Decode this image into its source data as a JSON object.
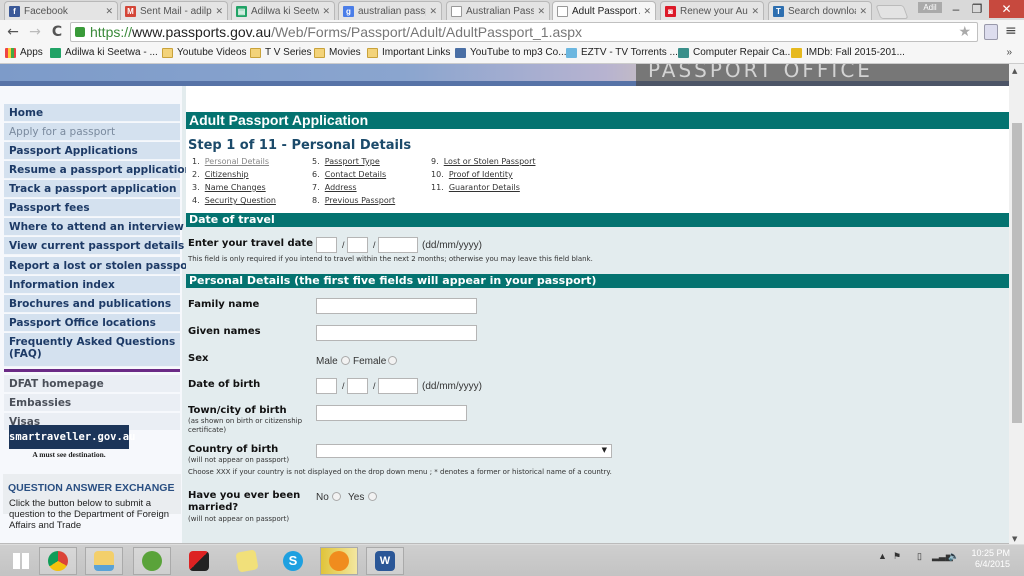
{
  "browser": {
    "tabs": [
      {
        "label": "Facebook",
        "icon": "facebook-icon",
        "color": "#3b5998",
        "glyph": "f",
        "active": false
      },
      {
        "label": "Sent Mail - adilp",
        "icon": "gmail-icon",
        "color": "#d44638",
        "glyph": "M",
        "active": false
      },
      {
        "label": "Adilwa ki Seetwa",
        "icon": "sheets-icon",
        "color": "#21a366",
        "glyph": "▤",
        "active": false
      },
      {
        "label": "australian passp",
        "icon": "google-icon",
        "color": "#4a7de8",
        "glyph": "g",
        "active": false
      },
      {
        "label": "Australian Passp",
        "icon": "page-icon",
        "color": "#ffffff",
        "glyph": "",
        "active": false
      },
      {
        "label": "Adult Passport A",
        "icon": "page-icon",
        "color": "#ffffff",
        "glyph": "",
        "active": true
      },
      {
        "label": "Renew your Aust",
        "icon": "auspost-icon",
        "color": "#dc1928",
        "glyph": "◙",
        "active": false
      },
      {
        "label": "Search download",
        "icon": "torrentz-icon",
        "color": "#2e6fb0",
        "glyph": "T",
        "active": false
      }
    ],
    "user_badge": "Adil",
    "window_controls": {
      "minimize": "–",
      "maximize": "❐",
      "close": "✕"
    },
    "url": {
      "scheme": "https://",
      "host": "www.passports.gov.au",
      "path": "/Web/Forms/Passport/Adult/AdultPassport_1.aspx"
    },
    "bookmarks": [
      {
        "label": "Apps",
        "icon": "apps-icon"
      },
      {
        "label": "Adilwa ki Seetwa - ...",
        "icon": "sheets-icon"
      },
      {
        "label": "Youtube Videos",
        "icon": "folder-icon"
      },
      {
        "label": "T V Series",
        "icon": "folder-icon"
      },
      {
        "label": "Movies",
        "icon": "folder-icon"
      },
      {
        "label": "Important Links",
        "icon": "folder-icon"
      },
      {
        "label": "YouTube to mp3 Co...",
        "icon": "yt-mp3-icon"
      },
      {
        "label": "EZTV - TV Torrents ...",
        "icon": "eztv-icon"
      },
      {
        "label": "Computer Repair Ca...",
        "icon": "house-icon"
      },
      {
        "label": "IMDb: Fall 2015-201...",
        "icon": "imdb-icon"
      }
    ],
    "bookmarks_overflow": "»"
  },
  "banner": {
    "text": "PASSPORT OFFICE"
  },
  "sidebar": {
    "items": [
      {
        "label": "Home",
        "muted": false
      },
      {
        "label": "Apply for a passport",
        "muted": true
      },
      {
        "label": "Passport Applications",
        "muted": false
      },
      {
        "label": "Resume a passport application",
        "muted": false
      },
      {
        "label": "Track a passport application",
        "muted": false
      },
      {
        "label": "Passport fees",
        "muted": false
      },
      {
        "label": "Where to attend an interview",
        "muted": false
      },
      {
        "label": "View current passport details",
        "muted": false
      },
      {
        "label": "Report a lost or stolen passport",
        "muted": false
      },
      {
        "label": "Information index",
        "muted": false
      },
      {
        "label": "Brochures and publications",
        "muted": false
      },
      {
        "label": "Passport Office locations",
        "muted": false
      },
      {
        "label": "Frequently Asked Questions (FAQ)",
        "muted": false
      }
    ],
    "external_links": [
      "DFAT homepage",
      "Embassies",
      "Visas"
    ],
    "smartraveller": {
      "title": "smartraveller.gov.au",
      "tagline": "A must see destination."
    },
    "qa": {
      "title": "QUESTION ANSWER EXCHANGE",
      "text": "Click the button below to submit a question to the Department of Foreign Affairs and Trade"
    }
  },
  "form": {
    "title": "Adult Passport Application",
    "step_title": "Step 1 of 11 - Personal Details",
    "steps": [
      {
        "num": "1.",
        "label": "Personal Details",
        "current": true
      },
      {
        "num": "2.",
        "label": "Citizenship",
        "current": false
      },
      {
        "num": "3.",
        "label": "Name Changes",
        "current": false
      },
      {
        "num": "4.",
        "label": "Security Question",
        "current": false
      },
      {
        "num": "5.",
        "label": "Passport Type",
        "current": false
      },
      {
        "num": "6.",
        "label": "Contact Details",
        "current": false
      },
      {
        "num": "7.",
        "label": "Address",
        "current": false
      },
      {
        "num": "8.",
        "label": "Previous Passport",
        "current": false
      },
      {
        "num": "9.",
        "label": "Lost or Stolen Passport",
        "current": false
      },
      {
        "num": "10.",
        "label": "Proof of Identity",
        "current": false
      },
      {
        "num": "11.",
        "label": "Guarantor Details",
        "current": false
      }
    ],
    "travel": {
      "section_title": "Date of travel",
      "label": "Enter your travel date",
      "day": "",
      "month": "",
      "year": "",
      "separator": "/",
      "format": "(dd/mm/yyyy)",
      "hint": "This field is only required if you intend to travel within the next 2 months; otherwise you may leave this field blank."
    },
    "personal": {
      "section_title": "Personal Details (the first five fields will appear in your passport)",
      "family_name": {
        "label": "Family name",
        "value": ""
      },
      "given_names": {
        "label": "Given names",
        "value": ""
      },
      "sex": {
        "label": "Sex",
        "options": [
          "Male",
          "Female"
        ],
        "selected": null
      },
      "dob": {
        "label": "Date of birth",
        "day": "",
        "month": "",
        "year": "",
        "separator": "/",
        "format": "(dd/mm/yyyy)"
      },
      "town": {
        "label": "Town/city of birth",
        "hint": "(as shown on birth or citizenship certificate)",
        "value": ""
      },
      "country": {
        "label": "Country of birth",
        "hint": "(will not appear on passport)",
        "value": "",
        "note": "Choose XXX if your country is not displayed on the drop down menu ; * denotes a former or historical name of a country."
      },
      "married": {
        "label": "Have you ever been married?",
        "hint": "(will not appear on passport)",
        "options": [
          "No",
          "Yes"
        ],
        "selected": null
      }
    }
  },
  "taskbar": {
    "apps": [
      "windows-start",
      "chrome",
      "file-explorer",
      "utorrent",
      "kaspersky",
      "sticky-notes",
      "skype",
      "media-player",
      "word"
    ],
    "time": "10:25 PM",
    "date": "6/4/2015"
  }
}
